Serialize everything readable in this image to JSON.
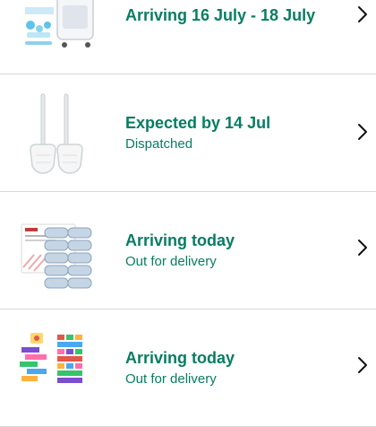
{
  "orders": [
    {
      "title": "Arriving 16 July - 18 July",
      "status": "",
      "image_icon": "air-cooler-icon"
    },
    {
      "title": "Expected by 14 Jul",
      "status": "Dispatched",
      "image_icon": "toilet-brush-icon"
    },
    {
      "title": "Arriving today",
      "status": "Out for delivery",
      "image_icon": "refill-pack-icon"
    },
    {
      "title": "Arriving today",
      "status": "Out for delivery",
      "image_icon": "stacking-blocks-icon"
    }
  ],
  "colors": {
    "status_green": "#067d62",
    "divider": "#d5d9d9",
    "chevron": "#111111"
  }
}
